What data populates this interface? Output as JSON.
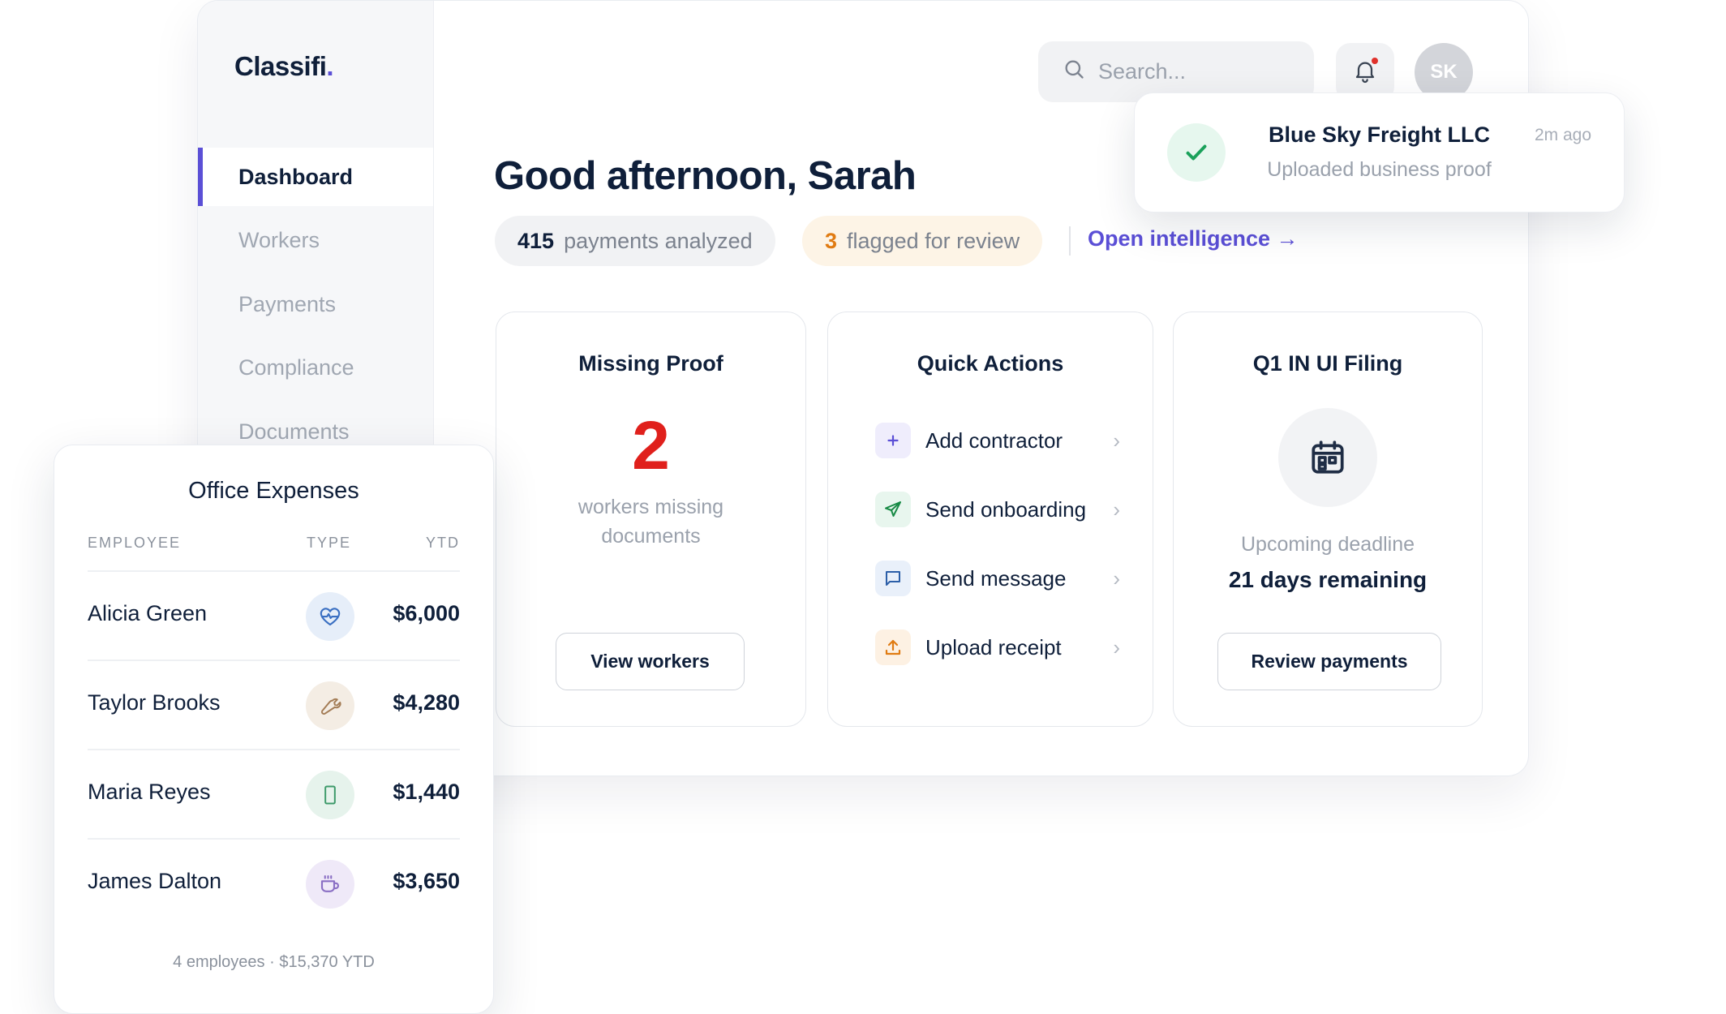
{
  "app": {
    "logo_text": "Classifi",
    "logo_dot": ".",
    "accent_color": "#5b4fd6"
  },
  "sidebar": {
    "items": [
      {
        "label": "Dashboard",
        "active": true
      },
      {
        "label": "Workers"
      },
      {
        "label": "Payments"
      },
      {
        "label": "Compliance"
      },
      {
        "label": "Documents"
      }
    ]
  },
  "header": {
    "search_placeholder": "Search...",
    "search_icon": "search-icon",
    "bell_icon": "bell-icon",
    "avatar_initials": "SK"
  },
  "main": {
    "greeting": "Good afternoon, Sarah",
    "stats": {
      "analyzed_count": "415",
      "analyzed_label": "payments analyzed",
      "flagged_count": "3",
      "flagged_label": "flagged for review"
    },
    "open_link": "Open intelligence →"
  },
  "cards": {
    "missing_proof": {
      "title": "Missing Proof",
      "count": "2",
      "sub_line1": "workers missing",
      "sub_line2": "documents",
      "button": "View workers"
    },
    "quick_actions": {
      "title": "Quick Actions",
      "items": [
        {
          "label": "Add contractor",
          "icon": "plus-icon",
          "color": "#5b4fd6",
          "bg": "#efedfc"
        },
        {
          "label": "Send onboarding",
          "icon": "send-icon",
          "color": "#178a45",
          "bg": "#e8f6ee"
        },
        {
          "label": "Send message",
          "icon": "message-icon",
          "color": "#2c5fa8",
          "bg": "#e9f0fa"
        },
        {
          "label": "Upload receipt",
          "icon": "upload-icon",
          "color": "#e07b12",
          "bg": "#fdf1e3"
        }
      ],
      "chevron": "›"
    },
    "filing": {
      "title": "Q1 IN UI Filing",
      "icon": "calendar-icon",
      "sub": "Upcoming deadline",
      "remaining": "21 days remaining",
      "button": "Review payments"
    }
  },
  "toast": {
    "title": "Blue Sky Freight LLC",
    "subtitle": "Uploaded business proof",
    "time": "2m ago",
    "icon": "check-icon"
  },
  "expenses": {
    "title": "Office Expenses",
    "columns": [
      "EMPLOYEE",
      "TYPE",
      "YTD"
    ],
    "rows": [
      {
        "name": "Alicia Green",
        "type_icon": "heart-pulse-icon",
        "amount": "$6,000"
      },
      {
        "name": "Taylor Brooks",
        "type_icon": "wrench-icon",
        "amount": "$4,280"
      },
      {
        "name": "Maria Reyes",
        "type_icon": "phone-icon",
        "amount": "$1,440"
      },
      {
        "name": "James Dalton",
        "type_icon": "coffee-icon",
        "amount": "$3,650"
      }
    ],
    "footer": "4 employees · $15,370 YTD"
  }
}
